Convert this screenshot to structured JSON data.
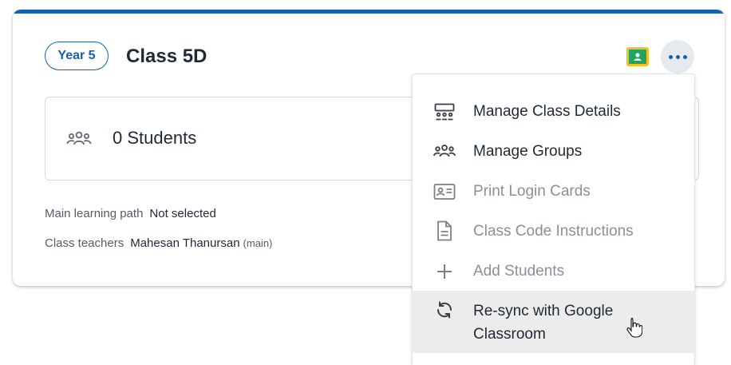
{
  "card": {
    "year_badge": "Year 5",
    "title": "Class 5D",
    "students_label": "0 Students",
    "learning_path_label": "Main learning path",
    "learning_path_value": "Not selected",
    "teachers_label": "Class teachers",
    "teacher_name": "Mahesan Thanursan",
    "teacher_note": "(main)"
  },
  "menu": {
    "items": [
      {
        "label": "Manage Class Details",
        "icon": "classroom-icon",
        "enabled": true
      },
      {
        "label": "Manage Groups",
        "icon": "group-icon",
        "enabled": true
      },
      {
        "label": "Print Login Cards",
        "icon": "id-card-icon",
        "enabled": false
      },
      {
        "label": "Class Code Instructions",
        "icon": "document-icon",
        "enabled": false
      },
      {
        "label": "Add Students",
        "icon": "plus-icon",
        "enabled": false
      },
      {
        "label": "Re-sync with Google",
        "label_line2": "Classroom",
        "icon": "sync-icon",
        "enabled": true
      }
    ]
  },
  "colors": {
    "accent": "#1660b4",
    "menu_highlight": "#ececec",
    "disabled_text": "#8a9099",
    "google_classroom_yellow": "#f3c21d",
    "google_classroom_green": "#21a366"
  }
}
